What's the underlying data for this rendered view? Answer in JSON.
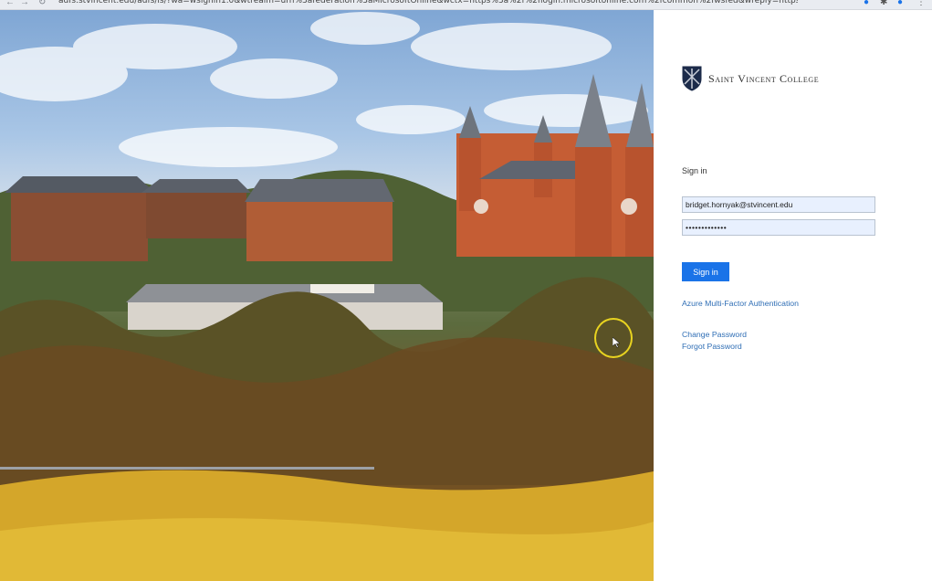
{
  "browser": {
    "back_icon": "back-arrow-icon",
    "forward_icon": "forward-arrow-icon",
    "reload_icon": "reload-icon",
    "url": "adfs.stvincent.edu/adfs/ls/?wa=wsignin1.0&wtrealm=urn%3afederation%3aMicrosoftOnline&wctx=https%3a%2f%2flogin.microsoftonline.com%2fcommon%2fwsfed&wreply=https%3a..."
  },
  "hero": {
    "image": "campus-photo",
    "description_icon": "college-campus-landscape"
  },
  "brand": {
    "name": "Saint Vincent College",
    "logo_icon": "shield-crest-icon"
  },
  "signin": {
    "heading": "Sign in",
    "email_value": "bridget.hornyak@stvincent.edu",
    "password_value": "•••••••••••••",
    "button_label": "Sign in"
  },
  "links": {
    "mfa": "Azure Multi-Factor Authentication",
    "change_password": "Change Password",
    "forgot_password": "Forgot Password"
  },
  "colors": {
    "accent": "#1a73e8",
    "link": "#2f6eb5",
    "cursor_highlight": "#e8d320"
  }
}
